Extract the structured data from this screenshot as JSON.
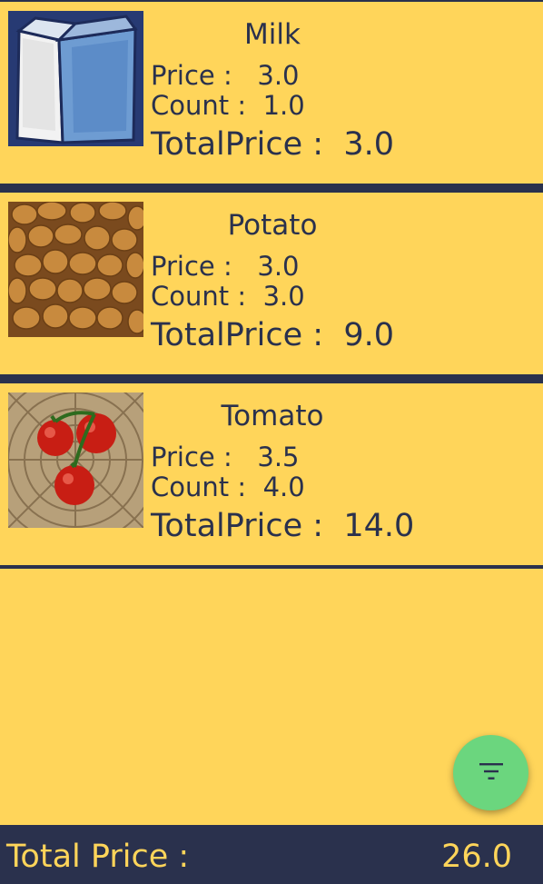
{
  "items": [
    {
      "name": "Milk",
      "price_label": "Price :",
      "price": "3.0",
      "count_label": "Count :",
      "count": "1.0",
      "total_label": "TotalPrice :",
      "total": "3.0",
      "image": "milk-carton-image"
    },
    {
      "name": "Potato",
      "price_label": "Price :",
      "price": "3.0",
      "count_label": "Count :",
      "count": "3.0",
      "total_label": "TotalPrice :",
      "total": "9.0",
      "image": "potatoes-image"
    },
    {
      "name": "Tomato",
      "price_label": "Price :",
      "price": "3.5",
      "count_label": "Count :",
      "count": "4.0",
      "total_label": "TotalPrice :",
      "total": "14.0",
      "image": "tomatoes-image"
    }
  ],
  "fab": {
    "icon": "filter-icon"
  },
  "footer": {
    "label": "Total Price :",
    "value": "26.0"
  },
  "colors": {
    "background": "#FFD55A",
    "text": "#2A314D",
    "footer": "#2A314D",
    "fab": "#6BD67E"
  }
}
